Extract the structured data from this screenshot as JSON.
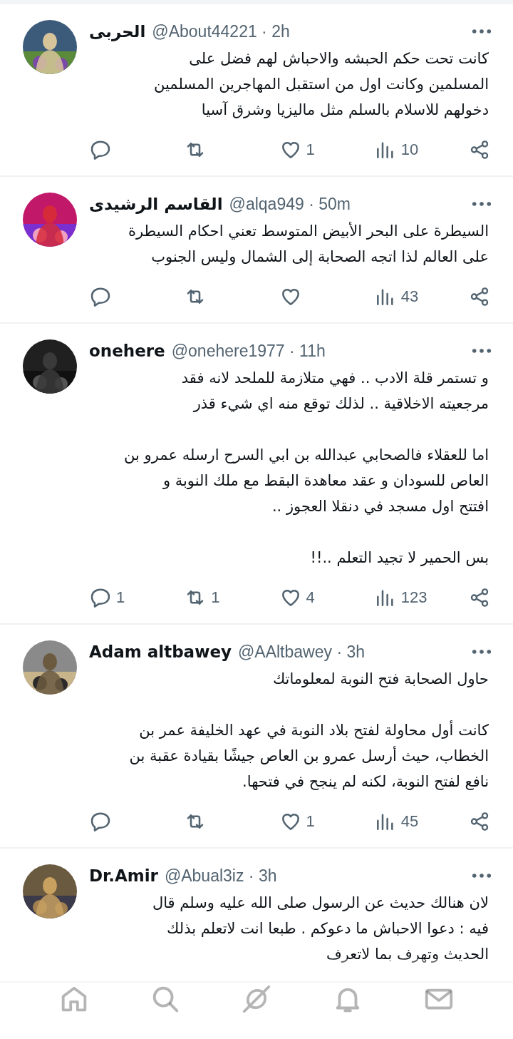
{
  "replies": [
    {
      "name": "الحربى",
      "meta": "@About44221 · 2h",
      "text": "كانت تحت حكم الحبشه والاحباش لهم فضل على\nالمسلمين وكانت اول من استقبل المهاجرين المسلمين\nدخولهم للاسلام بالسلم مثل ماليزيا وشرق آسيا",
      "stats": {
        "likes": "1",
        "views": "10"
      }
    },
    {
      "name": "القاسم الرشيدى",
      "meta": "@alqa949 · 50m",
      "text": "السيطرة على البحر الأبيض المتوسط تعني احكام السيطرة\nعلى العالم لذا اتجه الصحابة إلى الشمال وليس الجنوب",
      "stats": {
        "views": "43"
      }
    },
    {
      "name": "onehere",
      "meta": "@onehere1977 · 11h",
      "text": "و تستمر قلة الادب .. فهي متلازمة للملحد لانه فقد\nمرجعيته الاخلاقية .. لذلك توقع منه اي شيء قذر\n\nاما للعقلاء فالصحابي عبدالله بن ابي السرح ارسله عمرو بن\nالعاص للسودان و عقد معاهدة البقط مع ملك النوبة و\nافتتح اول مسجد في دنقلا العجوز ..\n\nبس الحمير لا تجيد التعلم ..!!",
      "stats": {
        "replies": "1",
        "reposts": "1",
        "likes": "4",
        "views": "123"
      }
    },
    {
      "name": "Adam altbawey",
      "meta": "@AAltbawey · 3h",
      "text": "حاول الصحابة فتح النوبة لمعلوماتك\n\nكانت أول محاولة لفتح بلاد النوبة في عهد الخليفة عمر بن\nالخطاب، حيث أرسل عمرو بن العاص جيشًا بقيادة عقبة بن\nنافع لفتح النوبة، لكنه لم ينجح في فتحها.",
      "stats": {
        "likes": "1",
        "views": "45"
      }
    },
    {
      "name": "Dr.Amir",
      "meta": "@Abual3iz · 3h",
      "text": "لان هنالك حديث عن الرسول صلى الله عليه وسلم قال\nفيه : دعوا الاحباش ما دعوكم  . طبعا انت لاتعلم بذلك\nالحديث وتهرف بما لاتعرف"
    }
  ],
  "nav": [
    {
      "kind": "home",
      "selected": false
    },
    {
      "kind": "search",
      "selected": false
    },
    {
      "kind": "grok",
      "selected": false
    },
    {
      "kind": "bell",
      "selected": false
    },
    {
      "kind": "mail",
      "selected": false
    }
  ]
}
